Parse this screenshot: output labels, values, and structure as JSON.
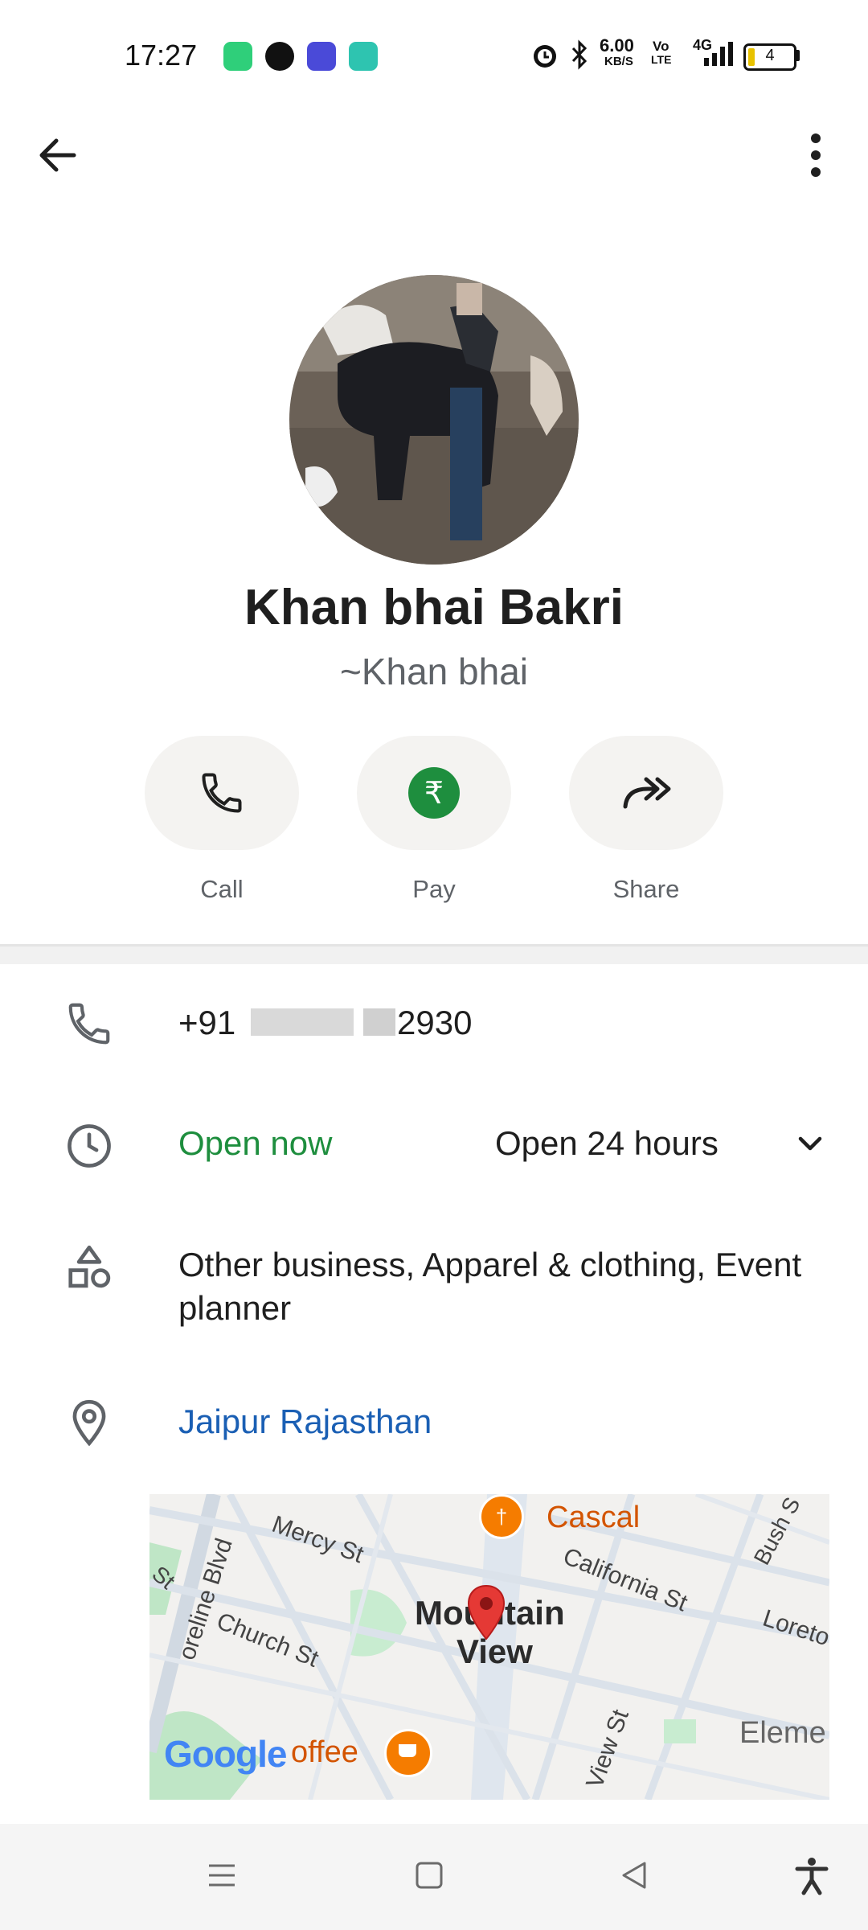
{
  "status": {
    "time": "17:27",
    "speed_value": "6.00",
    "speed_unit": "KB/S",
    "volte_top": "Vo",
    "volte_bottom": "LTE",
    "network": "4G",
    "battery": "4"
  },
  "profile": {
    "name": "Khan bhai Bakri",
    "subname": "~Khan bhai"
  },
  "actions": {
    "call": "Call",
    "pay": "Pay",
    "share": "Share",
    "rupee": "₹"
  },
  "info": {
    "phone_prefix": "+91",
    "phone_suffix": "2930",
    "open_status": "Open now",
    "hours": "Open 24 hours",
    "category": "Other business, Apparel & clothing, Event planner",
    "location": "Jaipur Rajasthan"
  },
  "map": {
    "labels": {
      "mercy": "Mercy St",
      "california": "California St",
      "church": "Church St",
      "shoreline": "oreline Blvd",
      "st": "St",
      "view_st": "View St",
      "bush": "Bush S",
      "loreto": "Loreto",
      "cascal": "Cascal",
      "mountain": "Mountain",
      "view": "View",
      "coffee": "offee",
      "eleme": "Eleme",
      "google": "Google"
    }
  },
  "colors": {
    "open_green": "#1e8e3e",
    "link_blue": "#1a5fb4",
    "pay_green": "#1e8e3e"
  }
}
